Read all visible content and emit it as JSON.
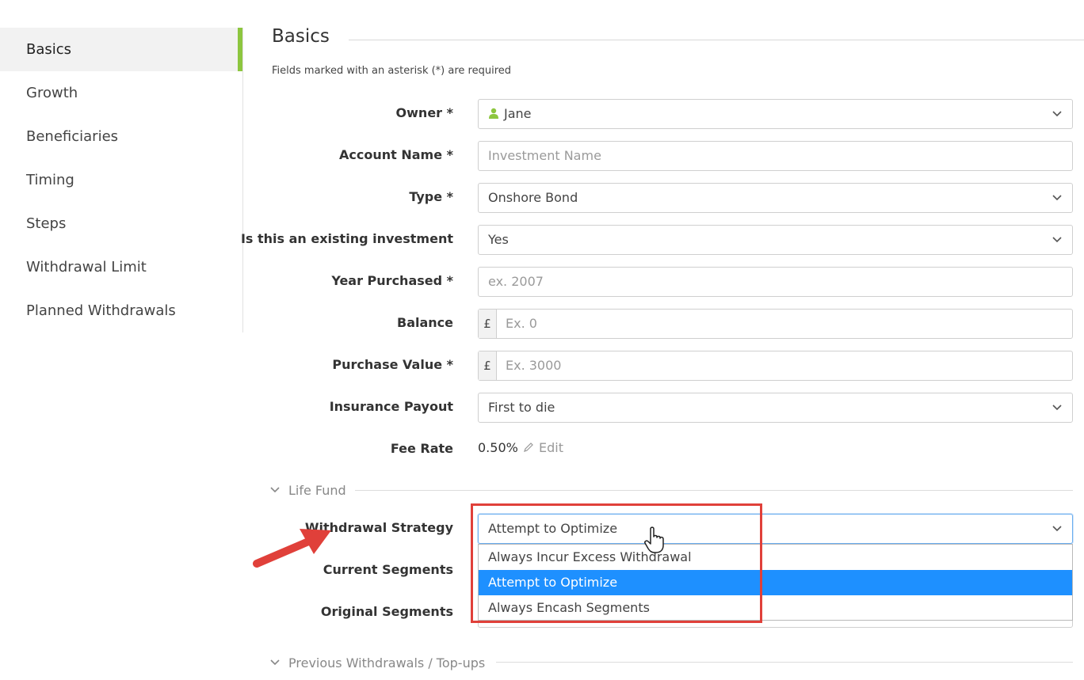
{
  "sidebar": {
    "items": [
      {
        "label": "Basics",
        "active": true
      },
      {
        "label": "Growth"
      },
      {
        "label": "Beneficiaries"
      },
      {
        "label": "Timing"
      },
      {
        "label": "Steps"
      },
      {
        "label": "Withdrawal Limit"
      },
      {
        "label": "Planned Withdrawals"
      }
    ]
  },
  "main": {
    "title": "Basics",
    "hint": "Fields marked with an asterisk (*) are required",
    "fields": {
      "owner": {
        "label": "Owner *",
        "value": "Jane"
      },
      "account_name": {
        "label": "Account Name *",
        "placeholder": "Investment Name"
      },
      "type": {
        "label": "Type *",
        "value": "Onshore Bond"
      },
      "existing": {
        "label": "Is this an existing investment",
        "value": "Yes"
      },
      "year": {
        "label": "Year Purchased *",
        "placeholder": "ex. 2007"
      },
      "balance": {
        "label": "Balance",
        "currency": "£",
        "placeholder": "Ex. 0"
      },
      "purchase_value": {
        "label": "Purchase Value *",
        "currency": "£",
        "placeholder": "Ex. 3000"
      },
      "insurance": {
        "label": "Insurance Payout",
        "value": "First to die"
      },
      "fee": {
        "label": "Fee Rate",
        "value": "0.50%",
        "edit": "Edit"
      }
    },
    "life_fund": {
      "heading": "Life Fund",
      "withdrawal_strategy": {
        "label": "Withdrawal Strategy",
        "value": "Attempt to Optimize",
        "options": [
          "Always Incur Excess Withdrawal",
          "Attempt to Optimize",
          "Always Encash Segments"
        ],
        "selected_index": 1
      },
      "current_segments": {
        "label": "Current Segments"
      },
      "original_segments": {
        "label": "Original Segments"
      }
    },
    "previous": {
      "heading": "Previous Withdrawals / Top-ups"
    }
  },
  "colors": {
    "accent": "#8dc63f",
    "selection": "#1e90ff",
    "annotation": "#e0403a"
  }
}
